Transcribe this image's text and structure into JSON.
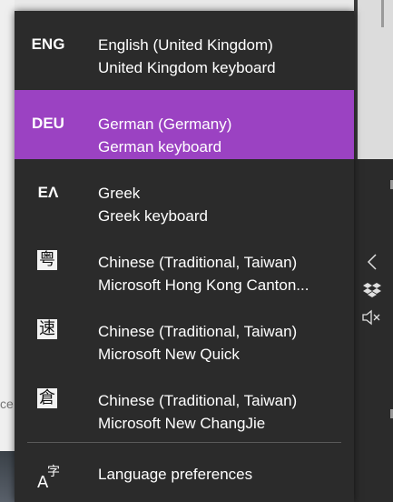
{
  "languages": [
    {
      "abbr": "ENG",
      "name": "English (United Kingdom)",
      "keyboard": "United Kingdom keyboard",
      "selected": false
    },
    {
      "abbr": "DEU",
      "name": "German (Germany)",
      "keyboard": "German keyboard",
      "selected": true
    },
    {
      "abbr": "ΕΛ",
      "name": "Greek",
      "keyboard": "Greek keyboard",
      "selected": false
    },
    {
      "glyph": "粤",
      "name": "Chinese (Traditional, Taiwan)",
      "keyboard": "Microsoft Hong Kong Canton...",
      "selected": false
    },
    {
      "glyph": "速",
      "name": "Chinese (Traditional, Taiwan)",
      "keyboard": "Microsoft New Quick",
      "selected": false
    },
    {
      "glyph": "倉",
      "name": "Chinese (Traditional, Taiwan)",
      "keyboard": "Microsoft New ChangJie",
      "selected": false
    }
  ],
  "preferences": {
    "label": "Language preferences",
    "icon": "language-icon"
  },
  "colors": {
    "flyout_bg": "#2b2b2b",
    "selected_bg": "#9b42c2",
    "text": "#ffffff"
  },
  "tray": {
    "chevron_icon": "chevron-left-icon",
    "dropbox_icon": "dropbox-icon",
    "mute_icon": "speaker-muted-icon"
  }
}
